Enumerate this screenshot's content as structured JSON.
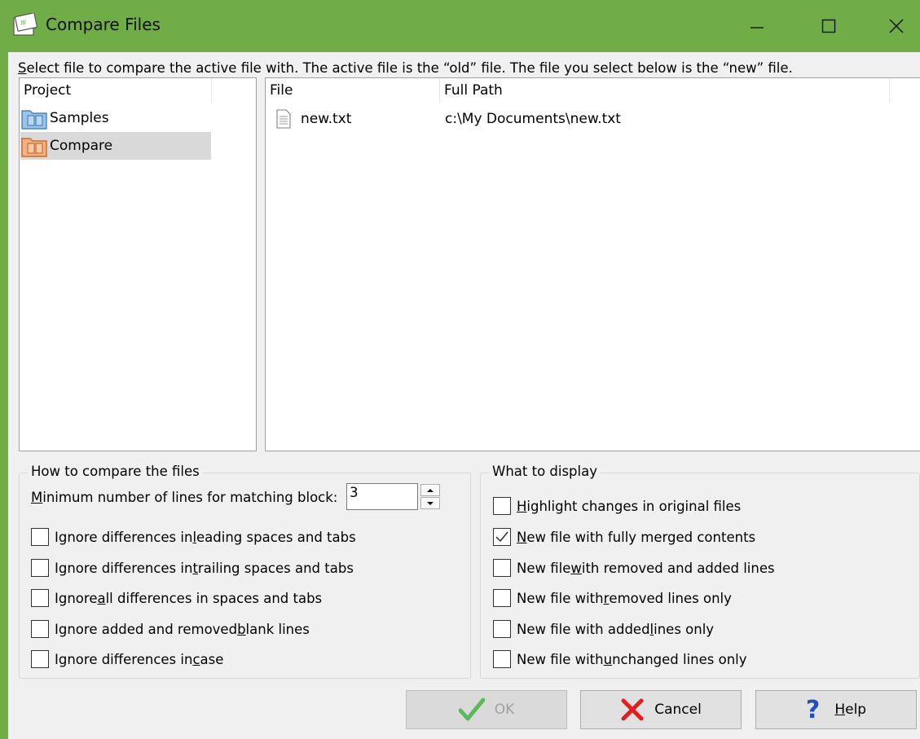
{
  "window": {
    "title": "Compare Files",
    "accent": "#70ad47"
  },
  "instruction": {
    "accel": "S",
    "rest": "elect file to compare the active file with.  The active file is the “old” file.  The file you select below is the “new” file."
  },
  "project_list": {
    "header": "Project",
    "items": [
      {
        "label": "Samples",
        "icon": "blue-folder-icon",
        "selected": false
      },
      {
        "label": "Compare",
        "icon": "orange-folder-icon",
        "selected": true
      }
    ]
  },
  "file_list": {
    "columns": [
      "File",
      "Full Path"
    ],
    "rows": [
      {
        "file": "new.txt",
        "path": "c:\\My Documents\\new.txt",
        "icon": "text-file-icon"
      }
    ]
  },
  "compare_group": {
    "legend": "How to compare the files",
    "min_lines": {
      "accel": "M",
      "rest": "inimum number of lines for matching block:",
      "value": "3"
    },
    "options": [
      {
        "pre": "Ignore differences in ",
        "accel": "l",
        "post": "eading spaces and tabs",
        "checked": false
      },
      {
        "pre": "Ignore differences in ",
        "accel": "t",
        "post": "railing spaces and tabs",
        "checked": false
      },
      {
        "pre": "Ignore ",
        "accel": "a",
        "post": "ll differences in spaces and tabs",
        "checked": false
      },
      {
        "pre": "Ignore added and removed ",
        "accel": "b",
        "post": "lank lines",
        "checked": false
      },
      {
        "pre": "Ignore differences in ",
        "accel": "c",
        "post": "ase",
        "checked": false
      }
    ]
  },
  "display_group": {
    "legend": "What to display",
    "options": [
      {
        "pre": "",
        "accel": "H",
        "post": "ighlight changes in original files",
        "checked": false
      },
      {
        "pre": "",
        "accel": "N",
        "post": "ew file with fully merged contents",
        "checked": true
      },
      {
        "pre": "New file ",
        "accel": "w",
        "post": "ith removed and added lines",
        "checked": false
      },
      {
        "pre": "New file with ",
        "accel": "r",
        "post": "emoved lines only",
        "checked": false
      },
      {
        "pre": "New file with added ",
        "accel": "l",
        "post": "ines only",
        "checked": false
      },
      {
        "pre": "New file with ",
        "accel": "u",
        "post": "nchanged lines only",
        "checked": false
      }
    ]
  },
  "buttons": {
    "ok": {
      "label": "OK",
      "enabled": false
    },
    "cancel": {
      "label": "Cancel"
    },
    "help": {
      "accel": "H",
      "rest": "elp"
    }
  }
}
